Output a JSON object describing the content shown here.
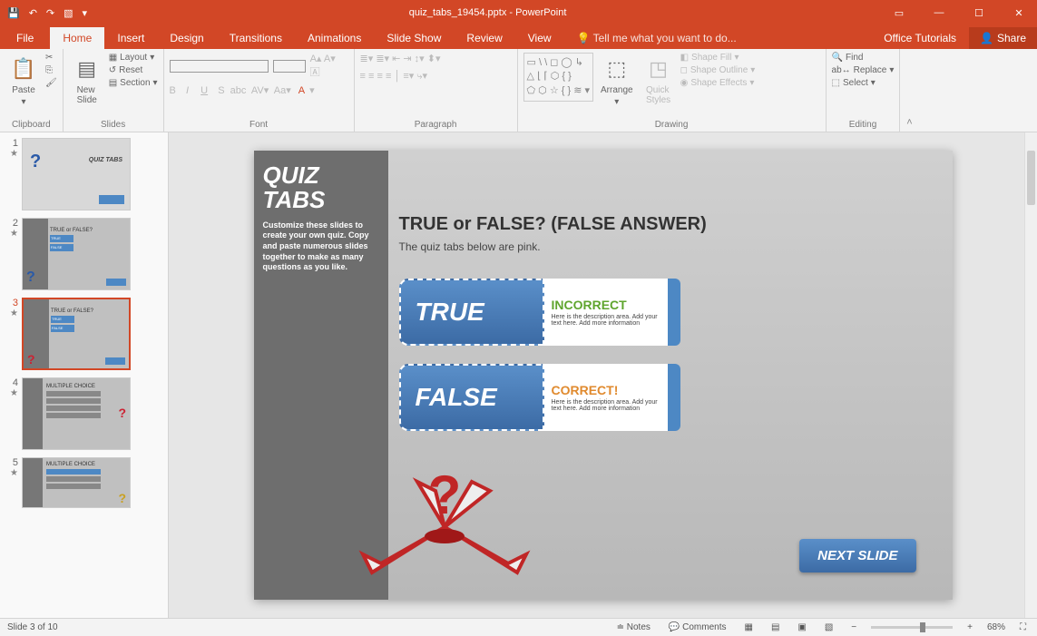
{
  "titlebar": {
    "filename": "quiz_tabs_19454.pptx - PowerPoint"
  },
  "tabs": {
    "file": "File",
    "home": "Home",
    "insert": "Insert",
    "design": "Design",
    "transitions": "Transitions",
    "animations": "Animations",
    "slideshow": "Slide Show",
    "review": "Review",
    "view": "View",
    "tellme": "Tell me what you want to do...",
    "tutorials": "Office Tutorials",
    "share": "Share"
  },
  "ribbon": {
    "clipboard": {
      "label": "Clipboard",
      "paste": "Paste"
    },
    "slides": {
      "label": "Slides",
      "newslide": "New\nSlide",
      "layout": "Layout",
      "reset": "Reset",
      "section": "Section"
    },
    "font": {
      "label": "Font"
    },
    "paragraph": {
      "label": "Paragraph"
    },
    "drawing": {
      "label": "Drawing",
      "arrange": "Arrange",
      "quick": "Quick\nStyles",
      "fill": "Shape Fill",
      "outline": "Shape Outline",
      "effects": "Shape Effects"
    },
    "editing": {
      "label": "Editing",
      "find": "Find",
      "replace": "Replace",
      "select": "Select"
    }
  },
  "thumbs": [
    {
      "n": "1"
    },
    {
      "n": "2"
    },
    {
      "n": "3"
    },
    {
      "n": "4"
    },
    {
      "n": "5"
    }
  ],
  "slide": {
    "sidebar_title": "QUIZ TABS",
    "sidebar_text": "Customize these slides to create your own quiz. Copy and paste numerous slides together to make as many questions as you like.",
    "heading": "TRUE or FALSE? (FALSE ANSWER)",
    "subheading": "The quiz tabs below are pink.",
    "true_label": "TRUE",
    "false_label": "FALSE",
    "incorrect": "INCORRECT",
    "correct": "CORRECT!",
    "desc_text": "Here is the description area. Add your text here.  Add more information",
    "next": "NEXT SLIDE"
  },
  "status": {
    "slide": "Slide 3 of 10",
    "notes": "Notes",
    "comments": "Comments",
    "zoom": "68%"
  }
}
